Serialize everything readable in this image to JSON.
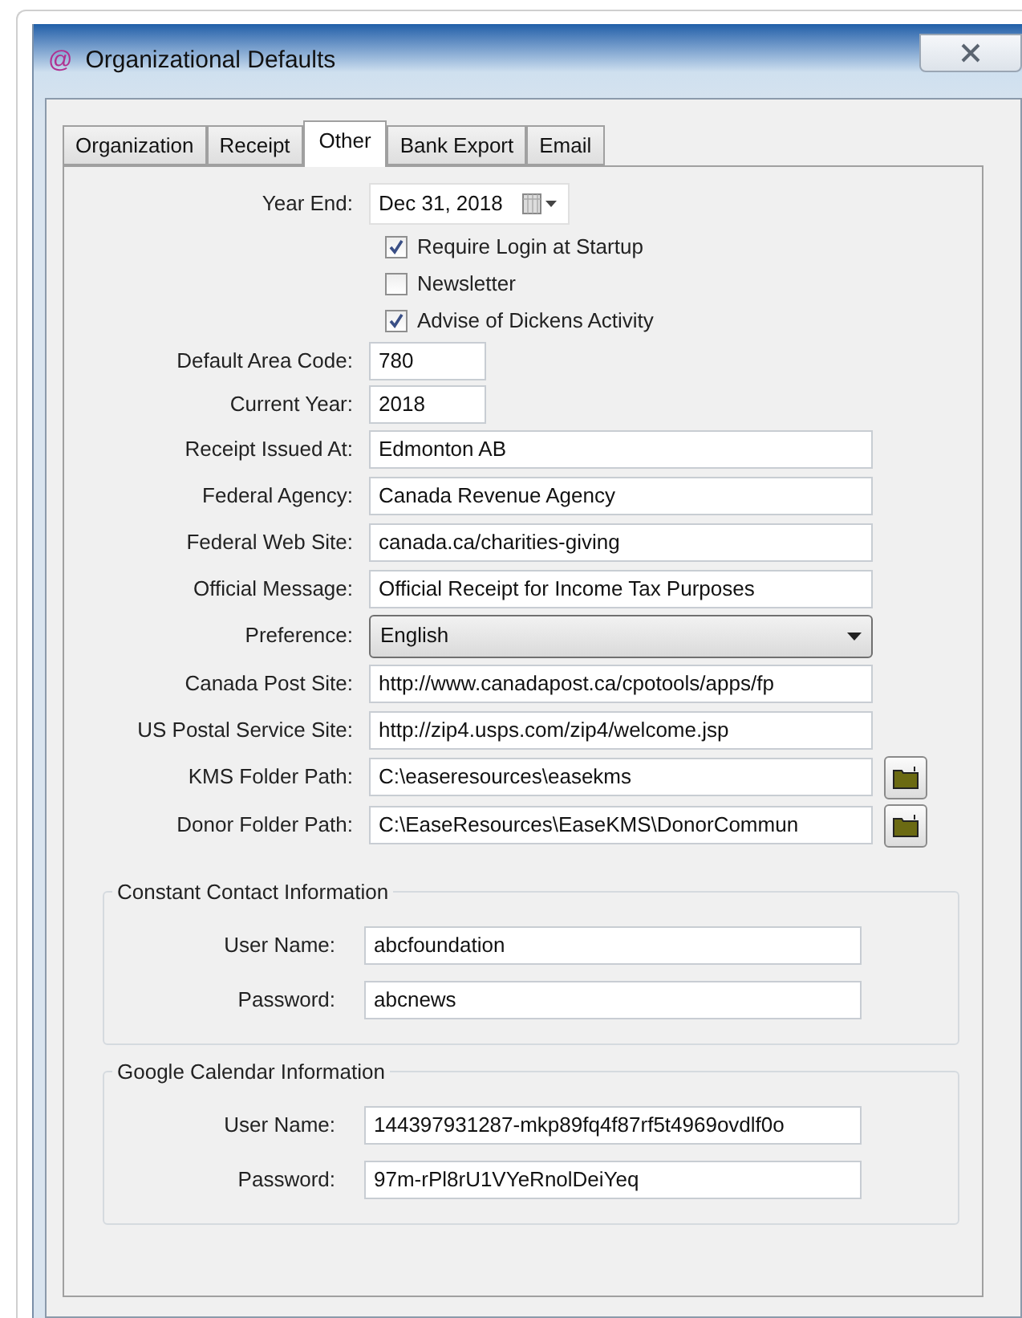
{
  "window": {
    "title": "Organizational Defaults",
    "icon_text": "@"
  },
  "tabs": [
    {
      "label": "Organization",
      "selected": false
    },
    {
      "label": "Receipt",
      "selected": false
    },
    {
      "label": "Other",
      "selected": true
    },
    {
      "label": "Bank Export",
      "selected": false
    },
    {
      "label": "Email",
      "selected": false
    }
  ],
  "fields": [
    {
      "kind": "date",
      "label": "Year End:",
      "value": "Dec 31, 2018"
    },
    {
      "kind": "checkbox",
      "label": "Require Login at Startup",
      "checked": true
    },
    {
      "kind": "checkbox",
      "label": "Newsletter",
      "checked": false
    },
    {
      "kind": "checkbox",
      "label": "Advise of Dickens Activity",
      "checked": true
    },
    {
      "kind": "short",
      "label": "Default Area Code:",
      "value": "780"
    },
    {
      "kind": "short",
      "label": "Current Year:",
      "value": "2018"
    },
    {
      "kind": "text",
      "label": "Receipt Issued At:",
      "value": "Edmonton AB"
    },
    {
      "kind": "text",
      "label": "Federal Agency:",
      "value": "Canada Revenue Agency"
    },
    {
      "kind": "text",
      "label": "Federal Web Site:",
      "value": "canada.ca/charities-giving"
    },
    {
      "kind": "text",
      "label": "Official Message:",
      "value": "Official Receipt for Income Tax Purposes"
    },
    {
      "kind": "select",
      "label": "Preference:",
      "value": "English"
    },
    {
      "kind": "text",
      "label": "Canada Post Site:",
      "value": "http://www.canadapost.ca/cpotools/apps/fp"
    },
    {
      "kind": "text",
      "label": "US Postal Service Site:",
      "value": "http://zip4.usps.com/zip4/welcome.jsp"
    },
    {
      "kind": "folder",
      "label": "KMS Folder Path:",
      "value": "C:\\easeresources\\easekms"
    },
    {
      "kind": "folder",
      "label": "Donor Folder Path:",
      "value": "C:\\EaseResources\\EaseKMS\\DonorCommun"
    }
  ],
  "groups": [
    {
      "title": "Constant Contact Information",
      "fields": [
        {
          "label": "User Name:",
          "value": "abcfoundation"
        },
        {
          "label": "Password:",
          "value": "abcnews"
        }
      ]
    },
    {
      "title": "Google Calendar Information",
      "fields": [
        {
          "label": "User Name:",
          "value": "144397931287-mkp89fq4f87rf5t4969ovdlf0o"
        },
        {
          "label": "Password:",
          "value": "97m-rPl8rU1VYeRnolDeiYeq"
        }
      ]
    }
  ]
}
